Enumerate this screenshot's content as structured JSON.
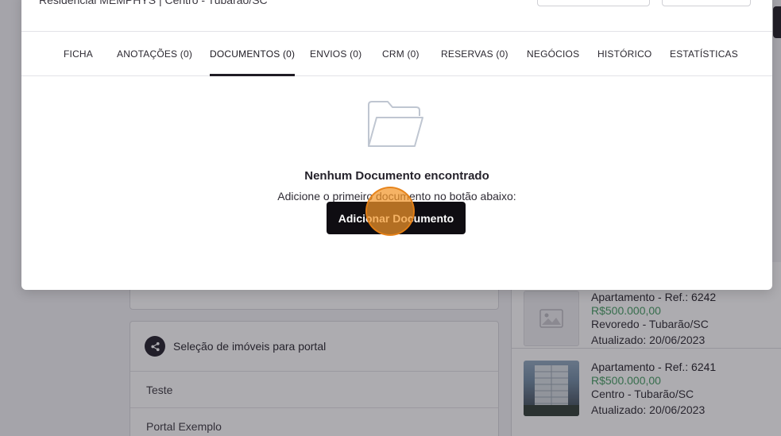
{
  "modal": {
    "subtitle": "Residencial MEMPHYS | Centro - Tubarão/SC",
    "tabs": [
      {
        "label": "FICHA"
      },
      {
        "label": "ANOTAÇÕES (0)"
      },
      {
        "label": "DOCUMENTOS (0)"
      },
      {
        "label": "ENVIOS (0)"
      },
      {
        "label": "CRM (0)"
      },
      {
        "label": "RESERVAS (0)"
      },
      {
        "label": "NEGÓCIOS"
      },
      {
        "label": "HISTÓRICO"
      },
      {
        "label": "ESTATÍSTICAS"
      }
    ],
    "active_tab": "DOCUMENTOS (0)",
    "empty_state": {
      "icon": "folder-icon",
      "title": "Nenhum Documento encontrado",
      "subtitle": "Adicione o primeiro documento no botão abaixo:",
      "button_label": "Adicionar Documento"
    }
  },
  "background": {
    "portal_section": {
      "icon": "share-icon",
      "title": "Seleção de imóveis para portal",
      "items": [
        "Teste",
        "Portal Exemplo"
      ]
    },
    "properties": [
      {
        "title": "Apartamento - Ref.: 6242",
        "price": "R$500.000,00",
        "location": "Revoredo - Tubarão/SC",
        "updated": "Atualizado: 20/06/2023",
        "thumb": "image-placeholder-icon"
      },
      {
        "title": "Apartamento - Ref.: 6241",
        "price": "R$500.000,00",
        "location": "Centro - Tubarão/SC",
        "updated": "Atualizado: 20/06/2023",
        "thumb": "building-photo"
      }
    ]
  },
  "colors": {
    "accent_dark": "#0f0d12",
    "price_green": "#3f9a5e",
    "click_marker": "#f3962a"
  }
}
